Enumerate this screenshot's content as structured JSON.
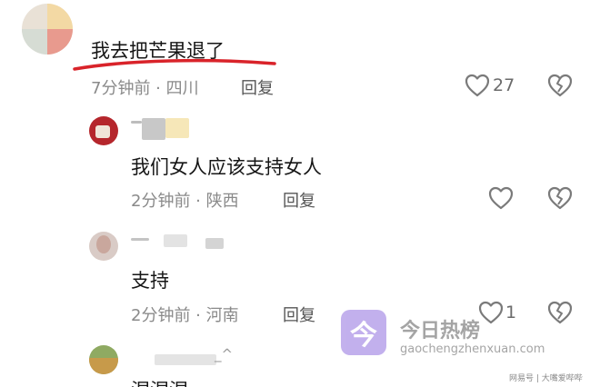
{
  "comments": [
    {
      "text": "我去把芒果退了",
      "meta": "7分钟前 · 四川",
      "reply_label": "回复",
      "like_count": "27"
    },
    {
      "text": "我们女人应该支持女人",
      "meta": "2分钟前 · 陕西",
      "reply_label": "回复",
      "like_count": ""
    },
    {
      "text": "支持",
      "meta": "2分钟前 · 河南",
      "reply_label": "回复",
      "like_count": "1"
    },
    {
      "text": "涅涅涅"
    }
  ],
  "fourth_username_suffix": "_^",
  "watermark": {
    "logo_char": "今",
    "title": "今日热榜",
    "url": "gaochengzhenxuan.com"
  },
  "footer": "网易号 | 大嘴爱哔哔",
  "colors": {
    "underline": "#d9232a",
    "icon_gray": "#7a7a7a",
    "watermark_purple": "#b8a3ea"
  },
  "icons": [
    "heart-icon",
    "broken-heart-icon"
  ]
}
